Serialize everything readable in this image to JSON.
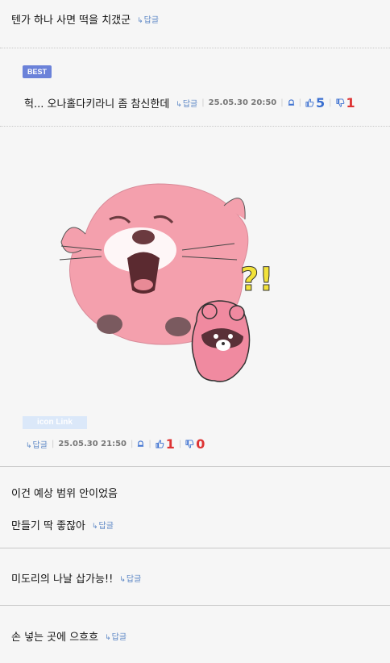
{
  "comments": [
    {
      "text": "텐가 하나 사면 떡을 치갰군",
      "reply": "답글"
    },
    {
      "badge": "BEST",
      "text": "헉... 오나홀다키라니 좀 참신한데",
      "reply": "답글",
      "date": "25.05.30 20:50",
      "likes": "5",
      "dislikes": "1"
    },
    {
      "sticker_label": "icon Link",
      "reply": "답글",
      "date": "25.05.30 21:50",
      "likes": "1",
      "dislikes": "0"
    },
    {
      "text": "이건 예상 범위 안이었음",
      "text2": "만들기 딱 좋잖아",
      "reply": "답글"
    },
    {
      "text": "미도리의 나날 삽가능!!",
      "reply": "답글"
    },
    {
      "text": "손 넣는 곳에 으흐흐",
      "reply": "답글"
    }
  ],
  "colors": {
    "accent": "#6b82d9",
    "like": "#3a6fd0",
    "dislike": "#dd3333",
    "reply": "#5b86c5"
  },
  "icons": {
    "reply": "reply-arrow-icon",
    "bell": "bell-icon",
    "like": "thumbs-up-icon",
    "dislike": "thumbs-down-icon"
  }
}
